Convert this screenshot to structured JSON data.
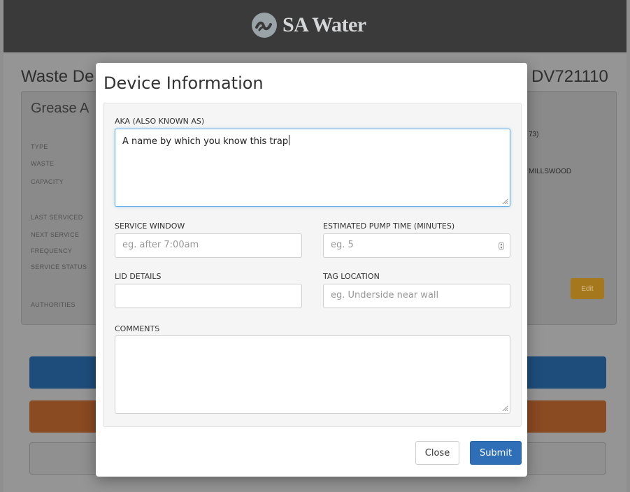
{
  "header": {
    "brand_name": "SA Water"
  },
  "background": {
    "page_title_left": "Waste De",
    "page_title_right": "DV721110",
    "card_title": "Grease A",
    "labels": [
      "TYPE",
      "WASTE",
      "CAPACITY",
      "LAST SERVICED",
      "NEXT SERVICE",
      "FREQUENCY",
      "SERVICE STATUS",
      "AUTHORITIES"
    ],
    "value_right_1": "73)",
    "value_right_2": "MILLSWOOD",
    "edit_label": "Edit"
  },
  "modal": {
    "title": "Device Information",
    "aka": {
      "label": "AKA (ALSO KNOWN AS)",
      "value": "A name by which you know this trap"
    },
    "service_window": {
      "label": "SERVICE WINDOW",
      "placeholder": "eg. after 7:00am"
    },
    "pump_time": {
      "label": "ESTIMATED PUMP TIME (MINUTES)",
      "placeholder": "eg. 5"
    },
    "lid_details": {
      "label": "LID DETAILS",
      "value": ""
    },
    "tag_location": {
      "label": "TAG LOCATION",
      "placeholder": "eg. Underside near wall"
    },
    "comments": {
      "label": "COMMENTS",
      "value": ""
    },
    "close_label": "Close",
    "submit_label": "Submit"
  },
  "colors": {
    "primary": "#2f6fb7",
    "focus": "#66afe9",
    "overlay": "#959595"
  }
}
